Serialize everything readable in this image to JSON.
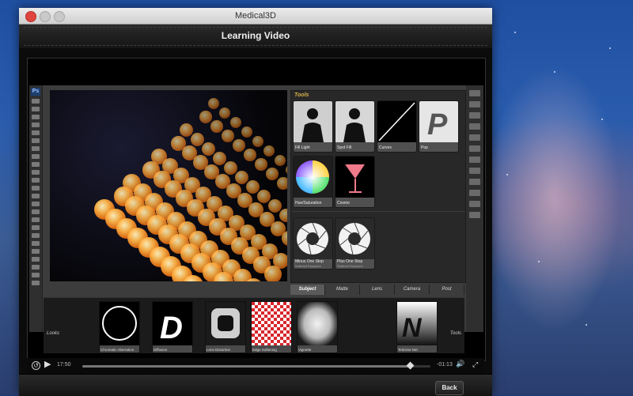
{
  "window": {
    "title": "Medical3D"
  },
  "header": {
    "title": "Learning Video"
  },
  "tools_panel": {
    "title": "Tools",
    "tiles": [
      {
        "label": "Fill Light"
      },
      {
        "label": "Spot Fill"
      },
      {
        "label": "Curves"
      },
      {
        "label": "Pop"
      },
      {
        "label": "Hue/Saturation"
      },
      {
        "label": "Cosmo"
      },
      {
        "label": "Minus One Stop",
        "sublabel": "Subtract Exposure"
      },
      {
        "label": "Plus One Stop",
        "sublabel": "Subtract Exposure"
      }
    ],
    "tabs": [
      {
        "label": "Subject",
        "active": true
      },
      {
        "label": "Matte",
        "active": false
      },
      {
        "label": "Lens",
        "active": false
      },
      {
        "label": "Camera",
        "active": false
      },
      {
        "label": "Post",
        "active": false
      }
    ]
  },
  "looks": {
    "label": "Looks",
    "tools_label": "Tools",
    "items": [
      {
        "label": "Chromatic Aberration"
      },
      {
        "label": "Diffusion"
      },
      {
        "label": "Lens Distortion"
      },
      {
        "label": "Edge Softening"
      },
      {
        "label": "Vignette"
      },
      {
        "label": "Telezine Net"
      }
    ]
  },
  "player": {
    "elapsed": "17:50",
    "remaining": "-01:13",
    "progress": 0.94
  },
  "footer": {
    "back_label": "Back"
  },
  "colors": {
    "accent": "#d9b04a",
    "close": "#e0443e"
  }
}
